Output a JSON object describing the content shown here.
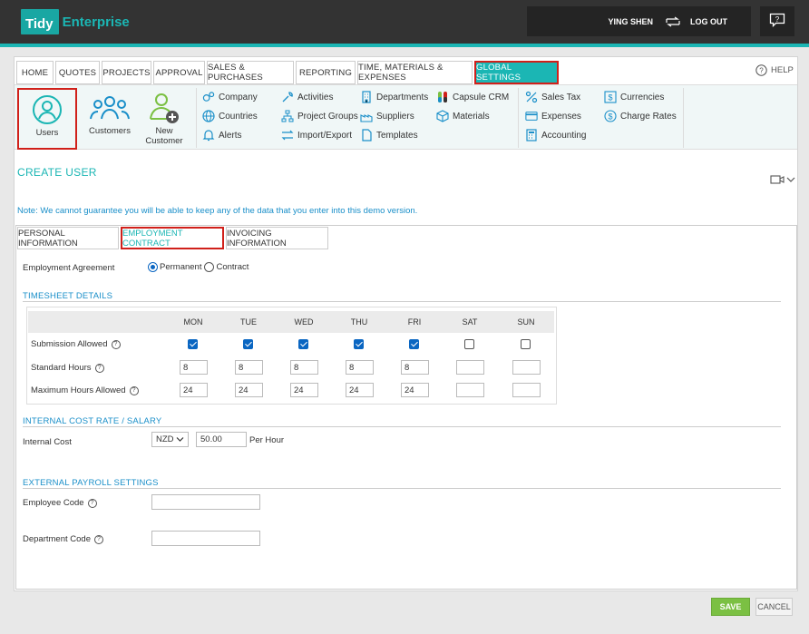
{
  "header": {
    "logo_box": "Tidy",
    "logo_text": "Enterprise",
    "user_name": "YING SHEN",
    "logout": "LOG OUT"
  },
  "nav": {
    "tabs": [
      {
        "label": "HOME"
      },
      {
        "label": "QUOTES"
      },
      {
        "label": "PROJECTS"
      },
      {
        "label": "APPROVAL"
      },
      {
        "label": "SALES & PURCHASES"
      },
      {
        "label": "REPORTING"
      },
      {
        "label": "TIME, MATERIALS & EXPENSES"
      },
      {
        "label": "GLOBAL SETTINGS"
      }
    ],
    "help": "HELP"
  },
  "modules": {
    "big": [
      {
        "label": "Users"
      },
      {
        "label": "Customers"
      },
      {
        "label": "New Customer"
      }
    ],
    "col1": [
      {
        "label": "Company"
      },
      {
        "label": "Countries"
      },
      {
        "label": "Alerts"
      }
    ],
    "col2": [
      {
        "label": "Activities"
      },
      {
        "label": "Project Groups"
      },
      {
        "label": "Import/Export"
      }
    ],
    "col3": [
      {
        "label": "Departments"
      },
      {
        "label": "Suppliers"
      },
      {
        "label": "Templates"
      }
    ],
    "col4": [
      {
        "label": "Capsule CRM"
      },
      {
        "label": "Materials"
      }
    ],
    "col5": [
      {
        "label": "Sales Tax"
      },
      {
        "label": "Expenses"
      },
      {
        "label": "Accounting"
      }
    ],
    "col6": [
      {
        "label": "Currencies"
      },
      {
        "label": "Charge Rates"
      }
    ]
  },
  "page": {
    "title": "CREATE USER",
    "note": "Note: We cannot guarantee you will be able to keep any of the data that you enter into this demo version."
  },
  "form_tabs": [
    {
      "label": "PERSONAL INFORMATION"
    },
    {
      "label": "EMPLOYMENT CONTRACT"
    },
    {
      "label": "INVOICING INFORMATION"
    }
  ],
  "employment": {
    "label": "Employment Agreement",
    "options": [
      "Permanent",
      "Contract"
    ],
    "selected": "Permanent"
  },
  "timesheet": {
    "heading": "TIMESHEET DETAILS",
    "days": [
      "MON",
      "TUE",
      "WED",
      "THU",
      "FRI",
      "SAT",
      "SUN"
    ],
    "rows": [
      {
        "label": "Submission Allowed",
        "checked": [
          true,
          true,
          true,
          true,
          true,
          false,
          false
        ]
      },
      {
        "label": "Standard Hours",
        "values": [
          "8",
          "8",
          "8",
          "8",
          "8",
          "",
          ""
        ]
      },
      {
        "label": "Maximum Hours Allowed",
        "values": [
          "24",
          "24",
          "24",
          "24",
          "24",
          "",
          ""
        ]
      }
    ]
  },
  "cost": {
    "heading": "INTERNAL COST RATE / SALARY",
    "label": "Internal Cost",
    "currency": "NZD",
    "value": "50.00",
    "unit": "Per Hour"
  },
  "payroll": {
    "heading": "EXTERNAL PAYROLL SETTINGS",
    "employee_code_label": "Employee Code",
    "employee_code": "",
    "department_code_label": "Department Code",
    "department_code": ""
  },
  "actions": {
    "save": "SAVE",
    "cancel": "CANCEL"
  },
  "colors": {
    "accent": "#1bb6b4",
    "highlight": "#d0201a",
    "save": "#7bc043",
    "link": "#1a8fc9"
  }
}
